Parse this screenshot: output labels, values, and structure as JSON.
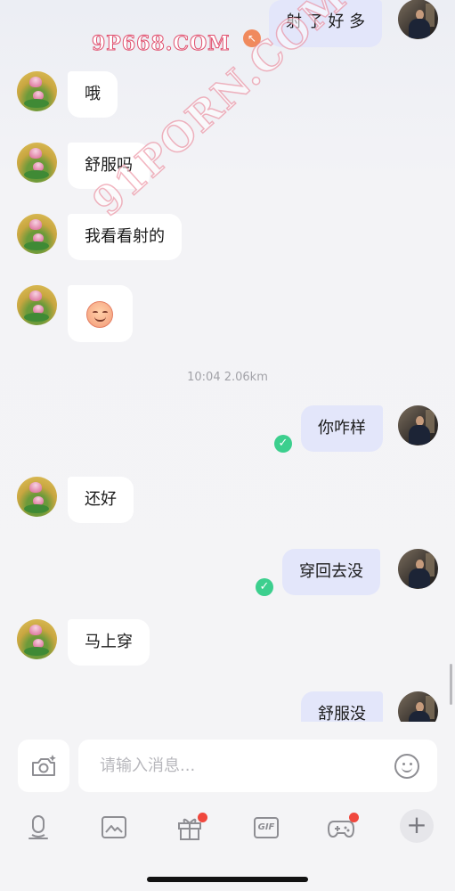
{
  "watermarks": {
    "top": "9P668.COM",
    "diagonal": "91PORN.COM"
  },
  "messages": {
    "m0": "射 了 好 多",
    "m1": "哦",
    "m2": "舒服吗",
    "m3": "我看看射的",
    "m4_emoji": "☺",
    "timestamp": "10:04 2.06km",
    "m5": "你咋样",
    "m6": "还好",
    "m7": "穿回去没",
    "m8": "马上穿",
    "m9": "舒服没"
  },
  "composer": {
    "placeholder": "请输入消息..."
  },
  "toolbar": {
    "items": [
      "voice-icon",
      "image-icon",
      "gift-icon",
      "gif-icon",
      "game-icon",
      "plus-icon"
    ],
    "gif_label": "GIF",
    "plus_label": "+",
    "badges": [
      "gift",
      "game"
    ]
  },
  "colors": {
    "outgoing_bubble": "#e3e6fa",
    "incoming_bubble": "#ffffff",
    "read_check": "#3ccf8e",
    "badge": "#f0473d"
  }
}
